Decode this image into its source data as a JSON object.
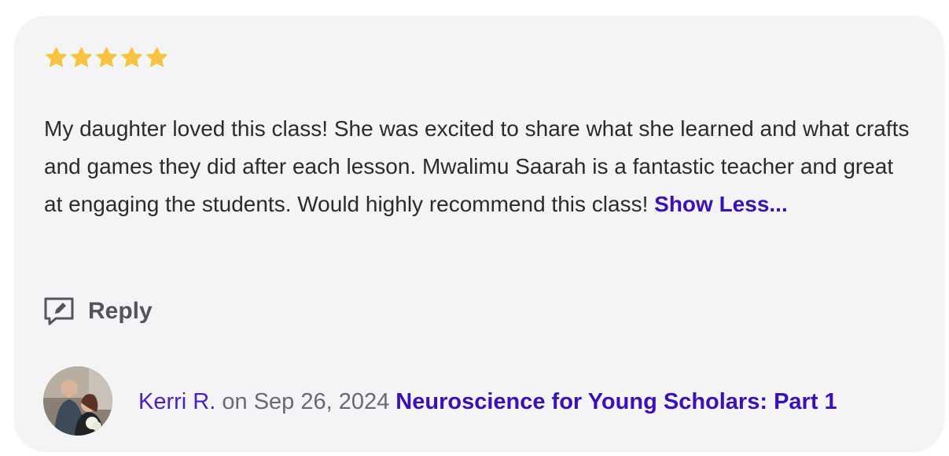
{
  "rating": {
    "stars": 5,
    "max": 5,
    "star_icon": "star-icon",
    "star_color": "#f6c342"
  },
  "review": {
    "text": "My daughter loved this class! She was excited to share what she learned and what crafts and games they did after each lesson. Mwalimu Saarah is a fantastic teacher and great at engaging the students. Would highly recommend this class!",
    "toggle_label": "Show Less..."
  },
  "actions": {
    "reply_label": "Reply",
    "reply_icon": "comment-edit-icon"
  },
  "footer": {
    "author": "Kerri R.",
    "date_prefix": "on",
    "date": "Sep 26, 2024",
    "course": "Neuroscience for Young Scholars: Part 1"
  },
  "colors": {
    "card_bg": "#f4f4f6",
    "link": "#3c10b8",
    "text": "#2b2b2b",
    "muted": "#6a6a6e"
  }
}
